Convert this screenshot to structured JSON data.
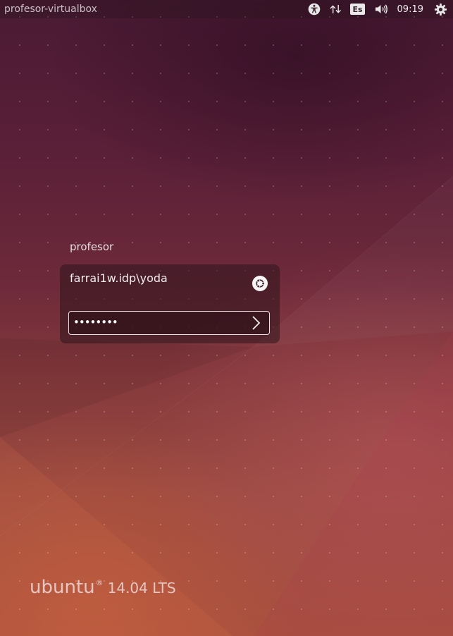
{
  "panel": {
    "hostname": "profesor-virtualbox",
    "keyboard_layout": "Es",
    "clock": "09:19",
    "icons": [
      "accessibility-icon",
      "network-icon",
      "volume-icon",
      "gear-icon"
    ]
  },
  "login": {
    "user_name": "profesor",
    "username_entry": "farrai1w.idp\\yoda",
    "password_masked": "••••••••",
    "session_icon": "ubuntu-session-icon",
    "submit_icon": "chevron-right-icon"
  },
  "branding": {
    "word": "ubuntu",
    "reg_mark": "®",
    "version": "14.04 LTS"
  },
  "colors": {
    "bg_top": "#4a1a34",
    "bg_bottom": "#a8503e",
    "accent": "#f5f5f5"
  }
}
